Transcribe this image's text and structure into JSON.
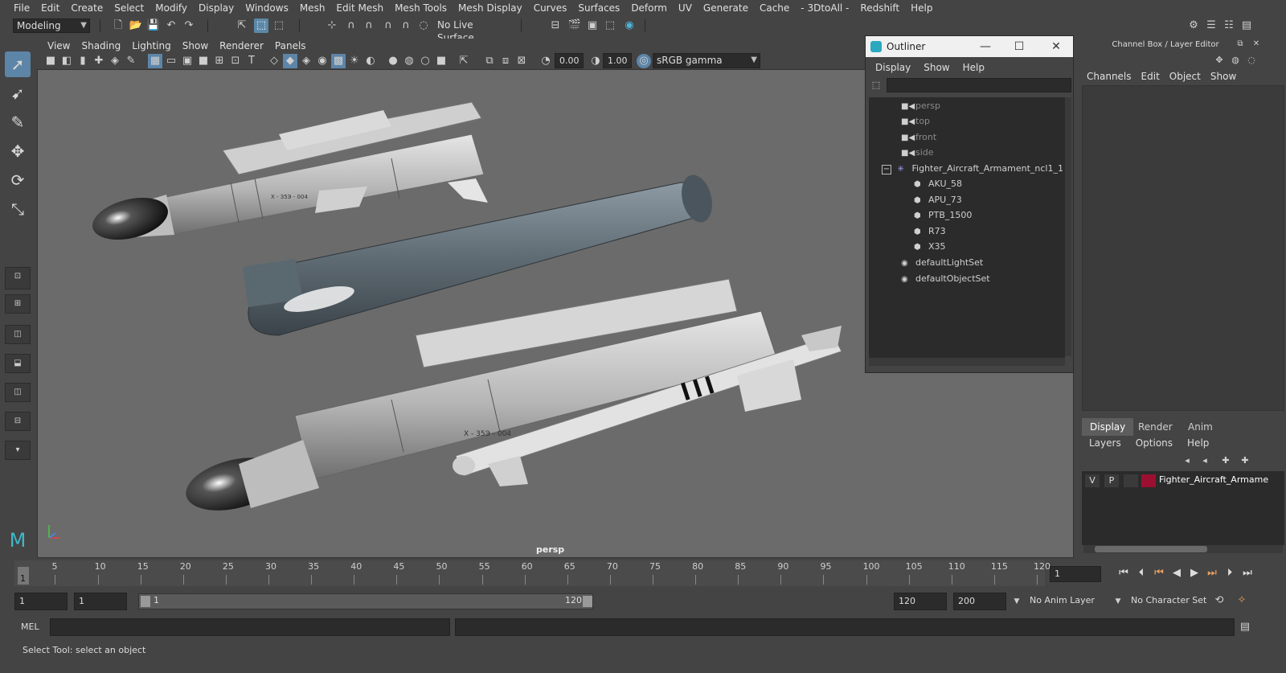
{
  "menubar": {
    "items": [
      "File",
      "Edit",
      "Create",
      "Select",
      "Modify",
      "Display",
      "Windows",
      "Mesh",
      "Edit Mesh",
      "Mesh Tools",
      "Mesh Display",
      "Curves",
      "Surfaces",
      "Deform",
      "UV",
      "Generate",
      "Cache",
      "- 3DtoAll -",
      "Redshift",
      "Help"
    ]
  },
  "statusline": {
    "mode": "Modeling",
    "live_surface": "No Live Surface"
  },
  "viewport": {
    "menu": [
      "View",
      "Shading",
      "Lighting",
      "Show",
      "Renderer",
      "Panels"
    ],
    "exposure": "0.00",
    "gamma": "1.00",
    "color_space": "sRGB gamma",
    "camera_label": "persp"
  },
  "outliner": {
    "title": "Outliner",
    "menu": [
      "Display",
      "Show",
      "Help"
    ],
    "items": [
      {
        "label": "persp",
        "dim": true
      },
      {
        "label": "top",
        "dim": true
      },
      {
        "label": "front",
        "dim": true
      },
      {
        "label": "side",
        "dim": true
      },
      {
        "label": "Fighter_Aircraft_Armament_ncl1_1",
        "dim": false
      },
      {
        "label": "AKU_58",
        "dim": false
      },
      {
        "label": "APU_73",
        "dim": false
      },
      {
        "label": "PTB_1500",
        "dim": false
      },
      {
        "label": "R73",
        "dim": false
      },
      {
        "label": "X35",
        "dim": false
      },
      {
        "label": "defaultLightSet",
        "dim": false
      },
      {
        "label": "defaultObjectSet",
        "dim": false
      }
    ]
  },
  "channelbox": {
    "title": "Channel Box / Layer Editor",
    "menu": [
      "Channels",
      "Edit",
      "Object",
      "Show"
    ]
  },
  "layereditor": {
    "tabs": [
      "Display",
      "Render",
      "Anim"
    ],
    "menu": [
      "Layers",
      "Options",
      "Help"
    ],
    "layer": {
      "v": "V",
      "p": "P",
      "name": "Fighter_Aircraft_Armame",
      "color": "#9b1030"
    }
  },
  "timeline": {
    "ticks": [
      "5",
      "10",
      "15",
      "20",
      "25",
      "30",
      "35",
      "40",
      "45",
      "50",
      "55",
      "60",
      "65",
      "70",
      "75",
      "80",
      "85",
      "90",
      "95",
      "100",
      "105",
      "110",
      "115",
      "120"
    ],
    "start_label": "1",
    "current_frame": "1"
  },
  "rangebar": {
    "start": "1",
    "playback_start": "1",
    "slider_start": "1",
    "slider_end": "120",
    "playback_end": "120",
    "end": "200",
    "anim_layer": "No Anim Layer",
    "character_set": "No Character Set"
  },
  "cmdline": {
    "label": "MEL"
  },
  "helpline": {
    "text": "Select Tool: select an object"
  },
  "colors": {
    "accent": "#5d85a8",
    "viewport_bg": "#6b6b6b",
    "panel_bg": "#444444",
    "field_bg": "#2b2b2b"
  }
}
